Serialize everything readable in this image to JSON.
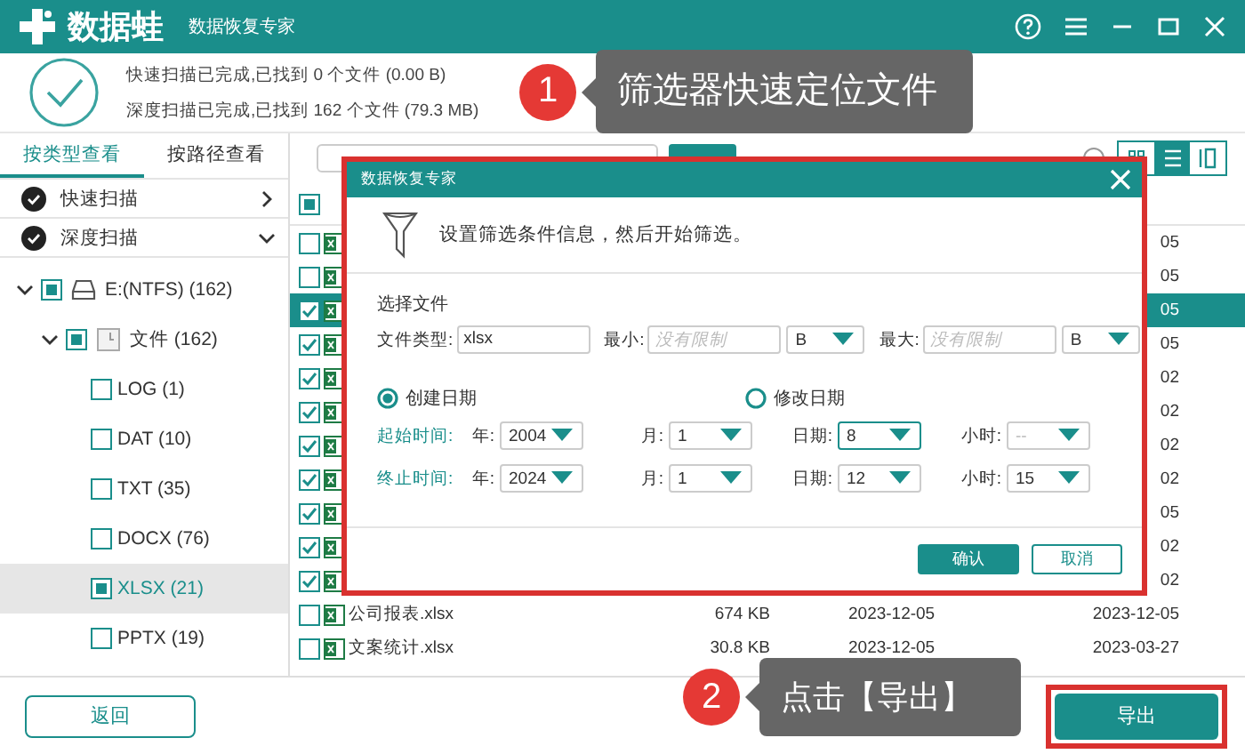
{
  "window": {
    "logo_text": "数据蛙",
    "title": "数据恢复专家"
  },
  "scan_summary": [
    "快速扫描已完成,已找到 0 个文件 (0.00  B)",
    "深度扫描已完成,已找到 162 个文件 (79.3 MB)"
  ],
  "view_tabs": [
    {
      "label": "按类型查看",
      "selected": true
    },
    {
      "label": "按路径查看",
      "selected": false
    }
  ],
  "scans": [
    {
      "label": "快速扫描",
      "expanded": false
    },
    {
      "label": "深度扫描",
      "expanded": true
    }
  ],
  "tree": [
    {
      "label": "E:(NTFS) (162)",
      "kind": "drive",
      "checked": false,
      "partial": true,
      "expanded": true,
      "selected": false,
      "children": [
        {
          "label": "文件 (162)",
          "kind": "folder",
          "checked": false,
          "partial": true,
          "expanded": true,
          "selected": false,
          "children": [
            {
              "label": "LOG (1)",
              "checked": false,
              "partial": false,
              "selected": false
            },
            {
              "label": "DAT (10)",
              "checked": false,
              "partial": false,
              "selected": false
            },
            {
              "label": "TXT (35)",
              "checked": false,
              "partial": false,
              "selected": false
            },
            {
              "label": "DOCX (76)",
              "checked": false,
              "partial": false,
              "selected": false
            },
            {
              "label": "XLSX (21)",
              "checked": false,
              "partial": true,
              "selected": true
            },
            {
              "label": "PPTX (19)",
              "checked": false,
              "partial": false,
              "selected": false
            }
          ]
        }
      ]
    }
  ],
  "back_button": "返回",
  "view_modes": [
    {
      "kind": "grid",
      "selected": false
    },
    {
      "kind": "list",
      "selected": true
    },
    {
      "kind": "columns",
      "selected": false
    }
  ],
  "file_table": {
    "header_checkbox": {
      "checked": false,
      "partial": true
    },
    "rows": [
      {
        "checked": false,
        "selected": false,
        "column_4": "05"
      },
      {
        "checked": false,
        "selected": false,
        "column_4": "05"
      },
      {
        "checked": true,
        "selected": true,
        "column_4": "05"
      },
      {
        "checked": true,
        "selected": false,
        "column_4": "05"
      },
      {
        "checked": true,
        "selected": false,
        "column_4": "02"
      },
      {
        "checked": true,
        "selected": false,
        "column_4": "02"
      },
      {
        "checked": true,
        "selected": false,
        "column_4": "02"
      },
      {
        "checked": true,
        "selected": false,
        "column_4": "02"
      },
      {
        "checked": true,
        "selected": false,
        "column_4": "05"
      },
      {
        "checked": true,
        "selected": false,
        "column_4": "02"
      },
      {
        "checked": true,
        "selected": false,
        "column_4": "02"
      },
      {
        "checked": false,
        "selected": false,
        "column_1": "公司报表.xlsx",
        "column_2": "674 KB",
        "column_3": "2023-12-05",
        "column_4": "2023-12-05"
      },
      {
        "checked": false,
        "selected": false,
        "column_1": "文案统计.xlsx",
        "column_2": "30.8 KB",
        "column_3": "2023-12-05",
        "column_4": "2023-03-27"
      }
    ]
  },
  "dialog": {
    "title": "数据恢复专家",
    "highlighted": true,
    "intro": "设置筛选条件信息，然后开始筛选。",
    "section": "选择文件",
    "file_type": {
      "label": "文件类型:",
      "value": "xlsx"
    },
    "min": {
      "label": "最小:",
      "placeholder": "没有限制",
      "unit": "B"
    },
    "max": {
      "label": "最大:",
      "placeholder": "没有限制",
      "unit": "B"
    },
    "date_modes": [
      {
        "label": "创建日期",
        "selected": true
      },
      {
        "label": "修改日期",
        "selected": false
      }
    ],
    "time_rows": [
      {
        "label": "起始时间:",
        "fields": [
          {
            "label": "年:",
            "value": "2004",
            "focused": false,
            "disabled": false
          },
          {
            "label": "月:",
            "value": "1",
            "focused": false,
            "disabled": false
          },
          {
            "label": "日期:",
            "value": "8",
            "focused": true,
            "disabled": false
          },
          {
            "label": "小时:",
            "value": "--",
            "focused": false,
            "disabled": true
          }
        ]
      },
      {
        "label": "终止时间:",
        "fields": [
          {
            "label": "年:",
            "value": "2024",
            "focused": false,
            "disabled": false
          },
          {
            "label": "月:",
            "value": "1",
            "focused": false,
            "disabled": false
          },
          {
            "label": "日期:",
            "value": "12",
            "focused": false,
            "disabled": false
          },
          {
            "label": "小时:",
            "value": "15",
            "focused": false,
            "disabled": false
          }
        ]
      }
    ],
    "buttons": [
      {
        "label": "确认",
        "kind": "primary"
      },
      {
        "label": "取消",
        "kind": "secondary"
      }
    ]
  },
  "export_button": {
    "label": "导出",
    "highlighted": true
  },
  "callouts": [
    {
      "number": "1",
      "text": "筛选器快速定位文件"
    },
    {
      "number": "2",
      "text": "点击【导出】"
    }
  ]
}
